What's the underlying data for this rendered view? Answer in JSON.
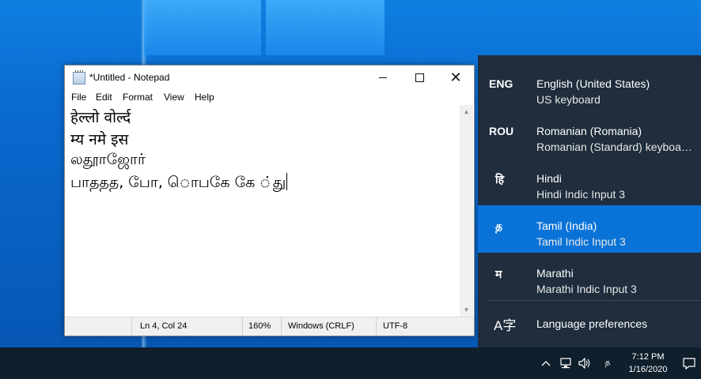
{
  "notepad": {
    "title": "*Untitled - Notepad",
    "menu": [
      "File",
      "Edit",
      "Format",
      "View",
      "Help"
    ],
    "lines": [
      "हेल्लो वोर्ल्द",
      "म्य नमे इस",
      "லதூாஜோர்",
      "பாததத, பாே, ொபகே கே ்து"
    ],
    "status": {
      "position": "Ln 4, Col 24",
      "zoom": "160%",
      "line_endings": "Windows (CRLF)",
      "encoding": "UTF-8"
    }
  },
  "language_flyout": {
    "languages": [
      {
        "code": "ENG",
        "name": "English (United States)",
        "keyboard": "US keyboard",
        "selected": false
      },
      {
        "code": "ROU",
        "name": "Romanian (Romania)",
        "keyboard": "Romanian (Standard) keyboa…",
        "selected": false
      },
      {
        "code": "हि",
        "name": "Hindi",
        "keyboard": "Hindi Indic Input 3",
        "selected": false
      },
      {
        "code": "த",
        "name": "Tamil (India)",
        "keyboard": "Tamil Indic Input 3",
        "selected": true
      },
      {
        "code": "म",
        "name": "Marathi",
        "keyboard": "Marathi Indic Input 3",
        "selected": false
      }
    ],
    "preferences_label": "Language preferences",
    "preferences_icon": "language-icon"
  },
  "taskbar": {
    "time": "7:12 PM",
    "date": "1/16/2020",
    "input_indicator": "த",
    "icons": [
      "chevron-up-icon",
      "network-icon",
      "volume-icon",
      "input-indicator-icon",
      "notification-icon"
    ]
  }
}
